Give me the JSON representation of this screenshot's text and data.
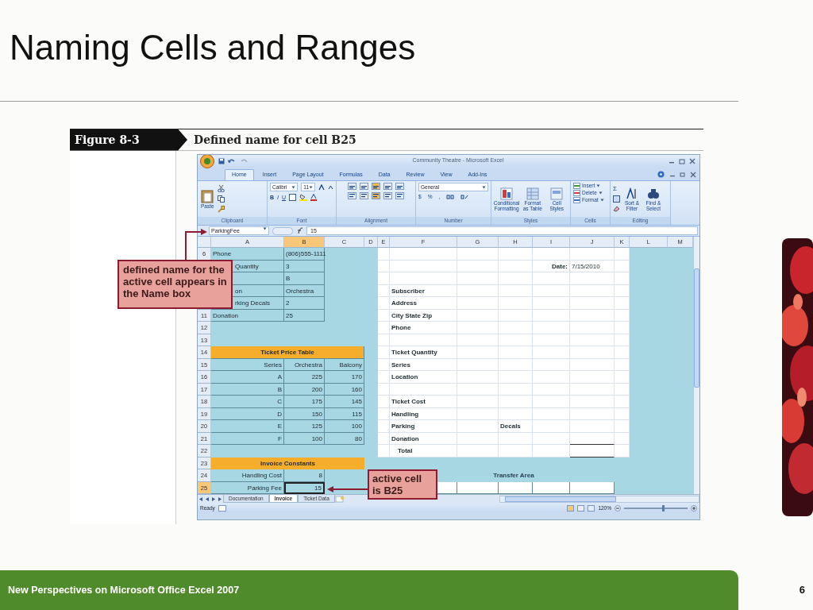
{
  "slide": {
    "title": "Naming Cells and Ranges",
    "figure_number": "Figure 8-3",
    "figure_caption": "Defined name for cell B25",
    "footer": "New Perspectives on Microsoft Office Excel 2007",
    "page_number": "6"
  },
  "excel": {
    "title": "Community Theatre - Microsoft Excel",
    "tabs": [
      {
        "label": "Home",
        "selected": true
      },
      {
        "label": "Insert",
        "selected": false
      },
      {
        "label": "Page Layout",
        "selected": false
      },
      {
        "label": "Formulas",
        "selected": false
      },
      {
        "label": "Data",
        "selected": false
      },
      {
        "label": "Review",
        "selected": false
      },
      {
        "label": "View",
        "selected": false
      },
      {
        "label": "Add-Ins",
        "selected": false
      }
    ],
    "ribbon": {
      "clipboard": {
        "label": "Clipboard",
        "paste": "Paste"
      },
      "font": {
        "label": "Font",
        "font_name": "Calibri",
        "font_size": "11",
        "styles": [
          "B",
          "I",
          "U"
        ]
      },
      "alignment": {
        "label": "Alignment"
      },
      "number": {
        "label": "Number",
        "format": "General",
        "symbols": [
          "$",
          "%",
          ","
        ]
      },
      "styles": {
        "label": "Styles",
        "buttons": [
          "Conditional Formatting",
          "Format as Table",
          "Cell Styles"
        ]
      },
      "cells": {
        "label": "Cells",
        "buttons": [
          "Insert",
          "Delete",
          "Format"
        ]
      },
      "editing": {
        "label": "Editing",
        "sum": "Σ",
        "buttons": [
          "Sort & Filter",
          "Find & Select"
        ]
      }
    },
    "name_box": "ParkingFee",
    "formula": "15",
    "columns": [
      {
        "label": "A",
        "selected": false
      },
      {
        "label": "B",
        "selected": true
      },
      {
        "label": "C",
        "selected": false
      },
      {
        "label": "D",
        "selected": false
      },
      {
        "label": "E",
        "selected": false
      },
      {
        "label": "F",
        "selected": false
      },
      {
        "label": "G",
        "selected": false
      },
      {
        "label": "H",
        "selected": false
      },
      {
        "label": "I",
        "selected": false
      },
      {
        "label": "J",
        "selected": false
      },
      {
        "label": "K",
        "selected": false
      },
      {
        "label": "L",
        "selected": false
      },
      {
        "label": "M",
        "selected": false
      }
    ],
    "rows": [
      {
        "number": "6",
        "selected": false,
        "cells": {
          "A": {
            "text": "Phone",
            "kind": "text"
          },
          "B": {
            "text": "(806)555-1111",
            "kind": "text"
          }
        }
      },
      {
        "cells": {
          "A": {
            "text": "Quantity",
            "kind": "clipped"
          },
          "B": {
            "text": "3",
            "kind": "text"
          },
          "I": {
            "text": "Date:",
            "kind": "label_right"
          },
          "J": {
            "text": "7/15/2010",
            "kind": "text"
          }
        }
      },
      {
        "cells": {
          "B": {
            "text": "B",
            "kind": "text"
          }
        }
      },
      {
        "cells": {
          "A": {
            "text": "on",
            "kind": "clipped"
          },
          "B": {
            "text": "Orchestra",
            "kind": "text"
          },
          "F": {
            "text": "Subscriber",
            "kind": "label"
          }
        }
      },
      {
        "cells": {
          "A": {
            "text": "rking Decals",
            "kind": "clipped"
          },
          "B": {
            "text": "2",
            "kind": "text"
          },
          "F": {
            "text": "Address",
            "kind": "label"
          }
        }
      },
      {
        "number": "11",
        "selected": false,
        "cells": {
          "A": {
            "text": "Donation",
            "kind": "text"
          },
          "B": {
            "text": "25",
            "kind": "text"
          },
          "F": {
            "text": "City State Zip",
            "kind": "label"
          }
        }
      },
      {
        "number": "12",
        "selected": false,
        "cells": {
          "F": {
            "text": "Phone",
            "kind": "label"
          }
        }
      },
      {
        "number": "13",
        "selected": false,
        "cells": {}
      },
      {
        "number": "14",
        "selected": false,
        "cells": {
          "A": {
            "text": "Ticket Price Table",
            "kind": "band"
          },
          "F": {
            "text": "Ticket Quantity",
            "kind": "label"
          }
        }
      },
      {
        "number": "15",
        "selected": false,
        "cells": {
          "A": {
            "text": "Series",
            "kind": "value"
          },
          "B": {
            "text": "Orchestra",
            "kind": "value"
          },
          "C": {
            "text": "Balcony",
            "kind": "value"
          },
          "F": {
            "text": "Series",
            "kind": "label"
          }
        }
      },
      {
        "number": "16",
        "selected": false,
        "cells": {
          "A": {
            "text": "A",
            "kind": "value"
          },
          "B": {
            "text": "225",
            "kind": "value"
          },
          "C": {
            "text": "170",
            "kind": "value"
          },
          "F": {
            "text": "Location",
            "kind": "label"
          }
        }
      },
      {
        "number": "17",
        "selected": false,
        "cells": {
          "A": {
            "text": "B",
            "kind": "value"
          },
          "B": {
            "text": "200",
            "kind": "value"
          },
          "C": {
            "text": "160",
            "kind": "value"
          }
        }
      },
      {
        "number": "18",
        "selected": false,
        "cells": {
          "A": {
            "text": "C",
            "kind": "value"
          },
          "B": {
            "text": "175",
            "kind": "value"
          },
          "C": {
            "text": "145",
            "kind": "value"
          },
          "F": {
            "text": "Ticket Cost",
            "kind": "label"
          }
        }
      },
      {
        "number": "19",
        "selected": false,
        "cells": {
          "A": {
            "text": "D",
            "kind": "value"
          },
          "B": {
            "text": "150",
            "kind": "value"
          },
          "C": {
            "text": "115",
            "kind": "value"
          },
          "F": {
            "text": "Handling",
            "kind": "label"
          }
        }
      },
      {
        "number": "20",
        "selected": false,
        "cells": {
          "A": {
            "text": "E",
            "kind": "value"
          },
          "B": {
            "text": "125",
            "kind": "value"
          },
          "C": {
            "text": "100",
            "kind": "value"
          },
          "F": {
            "text": "Parking",
            "kind": "label"
          },
          "H": {
            "text": "Decals",
            "kind": "label"
          }
        }
      },
      {
        "number": "21",
        "selected": false,
        "cells": {
          "A": {
            "text": "F",
            "kind": "value"
          },
          "B": {
            "text": "100",
            "kind": "value"
          },
          "C": {
            "text": "80",
            "kind": "value"
          },
          "F": {
            "text": "Donation",
            "kind": "label"
          }
        }
      },
      {
        "number": "22",
        "selected": false,
        "cells": {
          "F": {
            "text": "Total",
            "kind": "total"
          }
        }
      },
      {
        "number": "23",
        "selected": false,
        "cells": {
          "A": {
            "text": "Invoice Constants",
            "kind": "band"
          }
        }
      },
      {
        "number": "24",
        "selected": false,
        "cells": {
          "A": {
            "text": "Handling Cost",
            "kind": "value"
          },
          "B": {
            "text": "8",
            "kind": "value"
          },
          "G": {
            "text": "Transfer Area",
            "kind": "caption"
          }
        }
      },
      {
        "number": "25",
        "selected": true,
        "cells": {
          "A": {
            "text": "Parking Fee",
            "kind": "value"
          },
          "B": {
            "text": "15",
            "kind": "active"
          }
        }
      }
    ],
    "sheet_tabs": [
      {
        "label": "Documentation",
        "selected": false
      },
      {
        "label": "Invoice",
        "selected": true
      },
      {
        "label": "Ticket Data",
        "selected": false
      }
    ],
    "status": "Ready",
    "zoom": "120%",
    "zoom_slider": {
      "level": 0.6
    }
  },
  "callouts": [
    {
      "text": "defined name for the active cell appears in the Name box"
    },
    {
      "text": "active cell is B25"
    }
  ]
}
